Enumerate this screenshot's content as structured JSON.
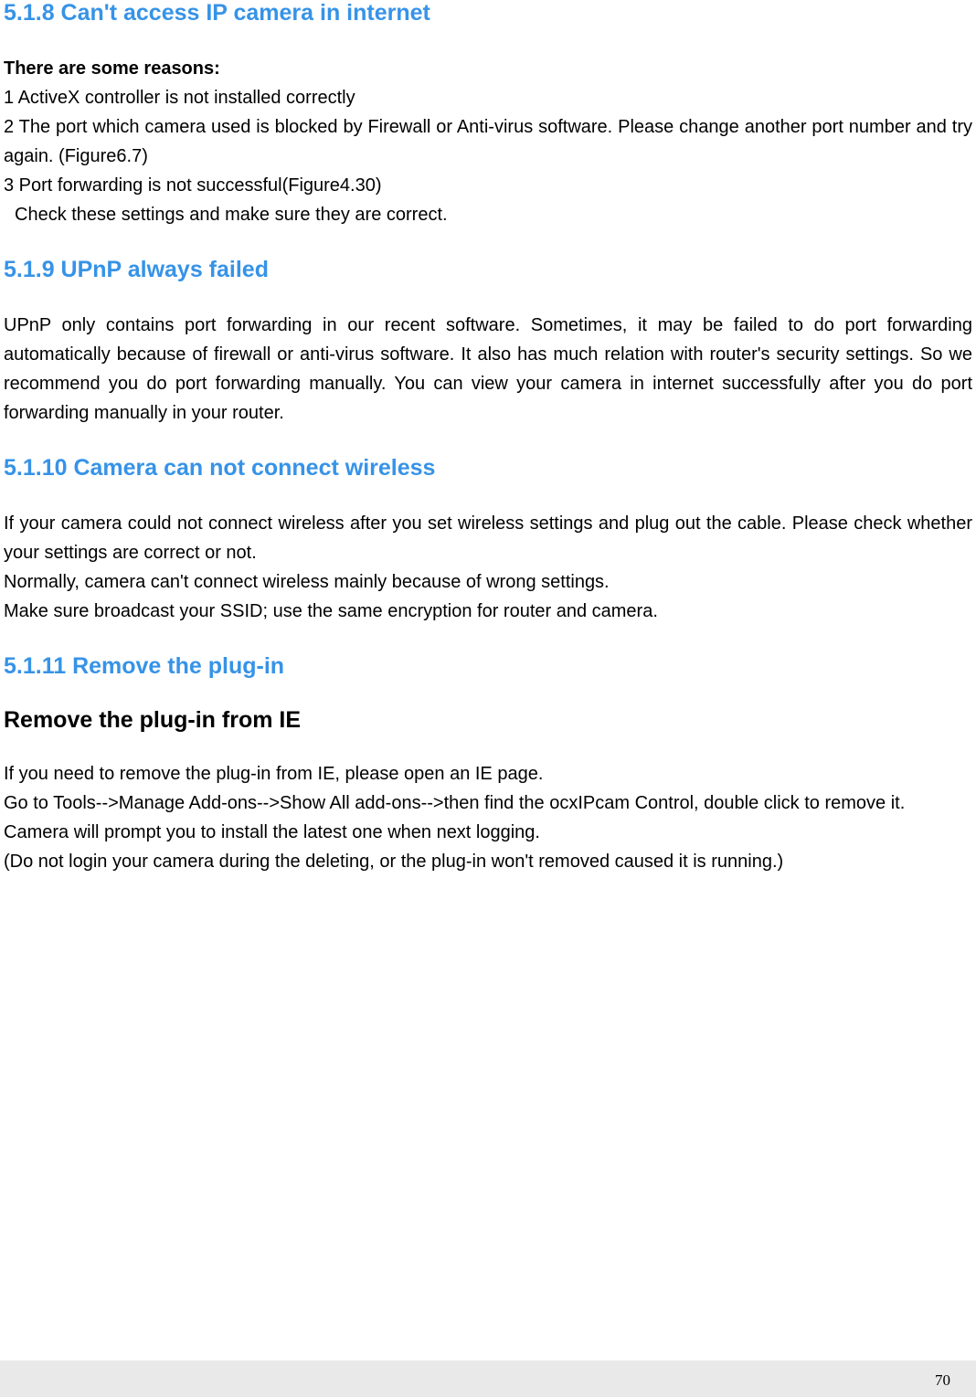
{
  "section_518": {
    "heading": "5.1.8 Can't access IP camera in internet",
    "reasons_label": "There are some reasons:",
    "reason1": "1 ActiveX controller is not installed correctly",
    "reason2": "2 The port which camera used is blocked by Firewall or Anti-virus software. Please change another port number and try again. (Figure6.7)",
    "reason3": "3 Port forwarding is not successful(Figure4.30)",
    "check": "Check these settings and make sure they are correct."
  },
  "section_519": {
    "heading": "5.1.9 UPnP always failed",
    "body": "UPnP only contains port forwarding in our recent software. Sometimes, it may be failed to do port forwarding automatically because of firewall or anti-virus software. It also has much relation with router's security settings. So we recommend you do port forwarding manually. You can view your camera in internet successfully after you do port forwarding manually in your router."
  },
  "section_5110": {
    "heading": "5.1.10 Camera can not connect wireless",
    "p1": "If your camera could not connect wireless after you set wireless settings and plug out the cable. Please check whether your settings are correct or not.",
    "p2": "Normally, camera can't connect wireless mainly because of wrong settings.",
    "p3": "Make sure broadcast your SSID; use the same encryption for router and camera."
  },
  "section_5111": {
    "heading": "5.1.11 Remove the plug-in",
    "subheading": "Remove the plug-in from IE",
    "p1": "If you need to remove the plug-in from IE, please open an IE page.",
    "p2": "Go to Tools-->Manage Add-ons-->Show All add-ons-->then find the ocxIPcam Control, double click to remove it.",
    "p3": "Camera will prompt you to install the latest one when next logging.",
    "p4": "(Do not login your camera during the deleting, or the plug-in won't removed caused it is running.)"
  },
  "page_number": "70"
}
